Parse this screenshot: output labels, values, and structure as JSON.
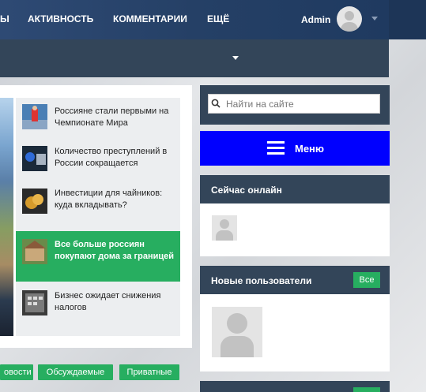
{
  "header": {
    "username": "Admin"
  },
  "nav": {
    "partial_item": "Ы",
    "items": [
      "АКТИВНОСТЬ",
      "КОММЕНТАРИИ",
      "ЕЩЁ"
    ]
  },
  "news": [
    {
      "title": "Россияне стали первыми на Чемпионате Мира",
      "active": false
    },
    {
      "title": "Количество преступлений в России сокращается",
      "active": false
    },
    {
      "title": "Инвестиции для чайников: куда вкладывать?",
      "active": false
    },
    {
      "title": "Все больше россиян покупают дома за границей",
      "active": true
    },
    {
      "title": "Бизнес ожидает снижения налогов",
      "active": false
    }
  ],
  "tags": [
    "овости",
    "Обсуждаемые",
    "Приватные"
  ],
  "sidebar": {
    "search_placeholder": "Найти на сайте",
    "menu_label": "Меню",
    "online_title": "Сейчас онлайн",
    "new_users_title": "Новые пользователи",
    "all_label": "Все"
  },
  "colors": {
    "accent_green": "#27ae60",
    "menu_blue": "#0000ff",
    "dark_panel": "#334559"
  }
}
